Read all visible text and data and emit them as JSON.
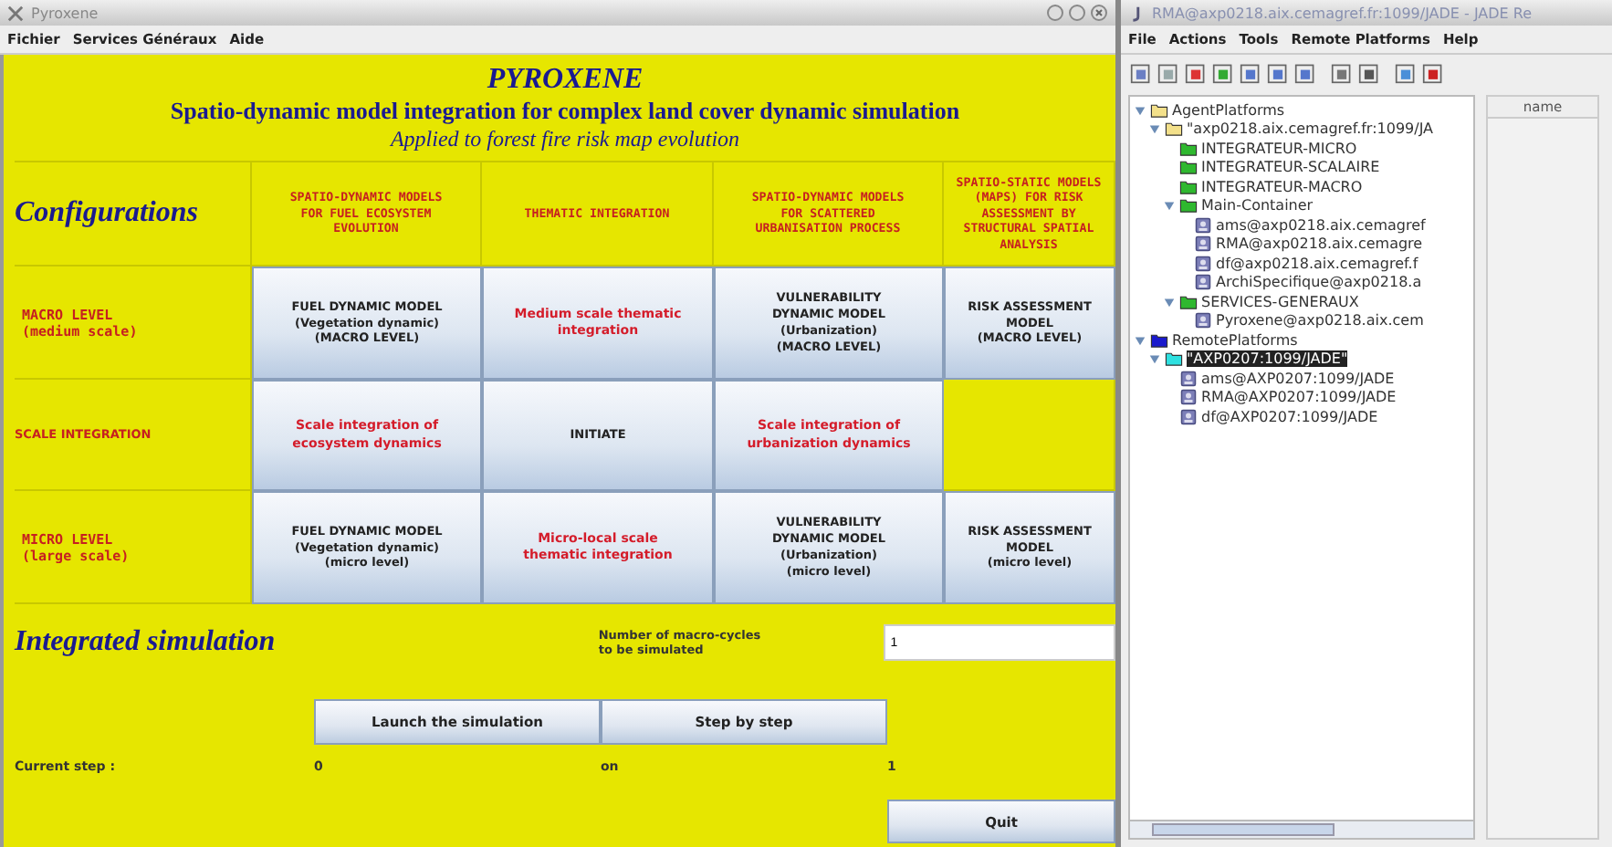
{
  "pyroxene_window": {
    "title": "Pyroxene",
    "menu": [
      "Fichier",
      "Services Généraux",
      "Aide"
    ],
    "header": {
      "title": "PYROXENE",
      "subtitle": "Spatio-dynamic model integration for complex land cover dynamic simulation",
      "tagline": "Applied to forest fire risk map evolution"
    },
    "grid": {
      "corner": "Configurations",
      "columns": [
        "SPATIO-DYNAMIC MODELS\nFOR FUEL ECOSYSTEM\nEVOLUTION",
        "THEMATIC INTEGRATION",
        "SPATIO-DYNAMIC MODELS\nFOR SCATTERED\nURBANISATION PROCESS",
        "SPATIO-STATIC MODELS\n(MAPS) FOR RISK\nASSESSMENT BY\nSTRUCTURAL SPATIAL\nANALYSIS"
      ],
      "rows": [
        {
          "label": "MACRO LEVEL\n(medium scale)",
          "kind": "level",
          "cells": [
            {
              "kind": "model",
              "text": "FUEL DYNAMIC MODEL\n(Vegetation dynamic)\n(MACRO LEVEL)"
            },
            {
              "kind": "integration",
              "text": "Medium scale thematic\nintegration"
            },
            {
              "kind": "model",
              "text": "VULNERABILITY\nDYNAMIC MODEL\n(Urbanization)\n(MACRO LEVEL)"
            },
            {
              "kind": "model",
              "text": "RISK ASSESSMENT MODEL\n(MACRO LEVEL)"
            }
          ]
        },
        {
          "label": "SCALE INTEGRATION",
          "kind": "integration",
          "cells": [
            {
              "kind": "integration",
              "text": "Scale integration of\necosystem dynamics"
            },
            {
              "kind": "model",
              "text": "INITIATE"
            },
            {
              "kind": "integration",
              "text": "Scale integration of\nurbanization dynamics"
            },
            {
              "kind": "empty"
            }
          ]
        },
        {
          "label": "MICRO LEVEL\n(large scale)",
          "kind": "level",
          "cells": [
            {
              "kind": "model",
              "text": "FUEL DYNAMIC MODEL\n(Vegetation dynamic)\n(micro level)"
            },
            {
              "kind": "integration",
              "text": "Micro-local scale\nthematic integration"
            },
            {
              "kind": "model",
              "text": "VULNERABILITY\nDYNAMIC MODEL\n(Urbanization)\n(micro level)"
            },
            {
              "kind": "model",
              "text": "RISK ASSESSMENT MODEL\n(micro level)"
            }
          ]
        }
      ]
    },
    "simulation": {
      "title": "Integrated simulation",
      "cycles_label": "Number of macro-cycles\nto be simulated",
      "cycles_value": "1",
      "launch_button": "Launch the simulation",
      "step_button": "Step by step",
      "current_step_label": "Current step :",
      "current_step": "0",
      "on_label": "on",
      "total_steps": "1",
      "quit_button": "Quit"
    }
  },
  "jade_window": {
    "title": "RMA@axp0218.aix.cemagref.fr:1099/JADE - JADE Re",
    "menu": [
      "File",
      "Actions",
      "Tools",
      "Remote Platforms",
      "Help"
    ],
    "tree": [
      {
        "label": "AgentPlatforms",
        "kind": "folder",
        "expanded": true,
        "selected": false,
        "children": [
          {
            "label": "\"axp0218.aix.cemagref.fr:1099/JA",
            "kind": "folder",
            "expanded": true,
            "selected": false,
            "children": [
              {
                "label": "INTEGRATEUR-MICRO",
                "kind": "container",
                "selected": false
              },
              {
                "label": "INTEGRATEUR-SCALAIRE",
                "kind": "container",
                "selected": false
              },
              {
                "label": "INTEGRATEUR-MACRO",
                "kind": "container",
                "selected": false
              },
              {
                "label": "Main-Container",
                "kind": "container",
                "expanded": true,
                "selected": false,
                "children": [
                  {
                    "label": "ams@axp0218.aix.cemagref",
                    "kind": "agent",
                    "selected": false
                  },
                  {
                    "label": "RMA@axp0218.aix.cemagre",
                    "kind": "agent",
                    "selected": false
                  },
                  {
                    "label": "df@axp0218.aix.cemagref.f",
                    "kind": "agent",
                    "selected": false
                  },
                  {
                    "label": "ArchiSpecifique@axp0218.a",
                    "kind": "agent",
                    "selected": false
                  }
                ]
              },
              {
                "label": "SERVICES-GENERAUX",
                "kind": "container",
                "expanded": true,
                "selected": false,
                "children": [
                  {
                    "label": "Pyroxene@axp0218.aix.cem",
                    "kind": "agent",
                    "selected": false
                  }
                ]
              }
            ]
          }
        ]
      },
      {
        "label": "RemotePlatforms",
        "kind": "remote",
        "expanded": true,
        "selected": false,
        "children": [
          {
            "label": "\"AXP0207:1099/JADE\"",
            "kind": "platform",
            "expanded": true,
            "selected": true,
            "children": [
              {
                "label": "ams@AXP0207:1099/JADE",
                "kind": "agent",
                "selected": false
              },
              {
                "label": "RMA@AXP0207:1099/JADE",
                "kind": "agent",
                "selected": false
              },
              {
                "label": "df@AXP0207:1099/JADE",
                "kind": "agent",
                "selected": false
              }
            ]
          }
        ]
      }
    ],
    "table_columns": [
      "name"
    ]
  }
}
